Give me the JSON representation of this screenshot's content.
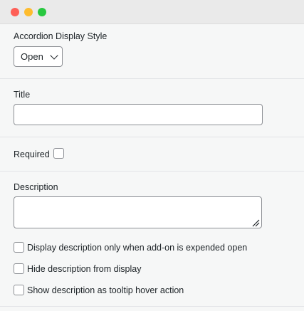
{
  "form": {
    "accordion_label": "Accordion Display Style",
    "accordion_value": "Open",
    "title_label": "Title",
    "title_value": "",
    "required_label": "Required",
    "description_label": "Description",
    "description_value": "",
    "options": [
      {
        "label": "Display description only when add-on is expended open",
        "checked": false
      },
      {
        "label": "Hide description from display",
        "checked": false
      },
      {
        "label": "Show description as tooltip hover action",
        "checked": false
      }
    ]
  },
  "icons": {
    "window_controls": [
      "close-icon",
      "minimize-icon",
      "maximize-icon"
    ],
    "select_arrow": "chevron-down-icon",
    "textarea_grip": "resize-grip-icon"
  },
  "colors": {
    "close": "#fe5f57",
    "minimize": "#febc2e",
    "maximize": "#28c840",
    "border": "#8c8f94",
    "background": "#f6f7f7"
  }
}
